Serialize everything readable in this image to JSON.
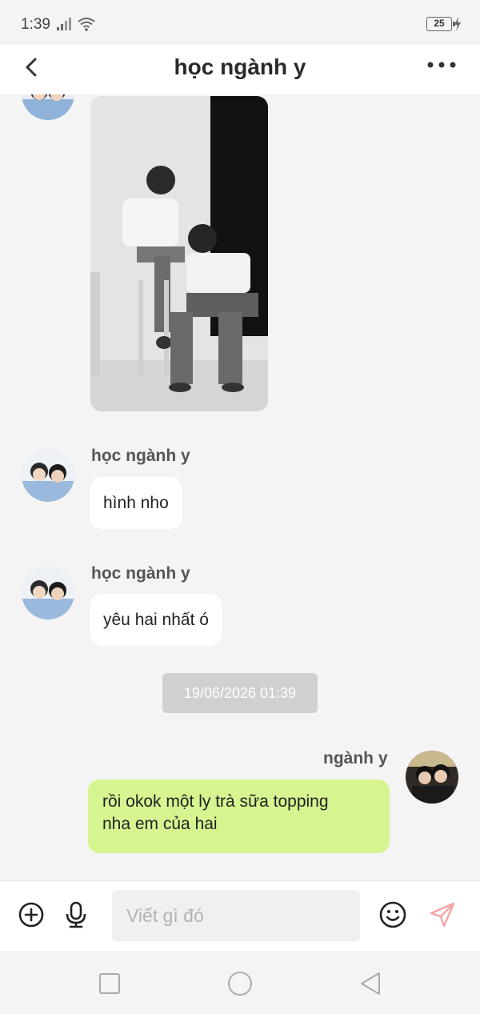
{
  "status_bar": {
    "time": "1:39",
    "battery": "25"
  },
  "header": {
    "title": "học ngành y"
  },
  "messages": [
    {
      "type": "image",
      "direction": "incoming",
      "description_icon": "photo"
    },
    {
      "type": "text",
      "direction": "incoming",
      "sender": "học ngành y",
      "text": "hình nho"
    },
    {
      "type": "text",
      "direction": "incoming",
      "sender": "học ngành y",
      "text": "yêu hai nhất ó"
    },
    {
      "type": "timestamp",
      "text": "19/06/2026 01:39"
    },
    {
      "type": "text",
      "direction": "outgoing",
      "sender": "ngành y",
      "lines": [
        "rồi okok một ly trà sữa topping",
        "nha em của hai"
      ]
    }
  ],
  "composer": {
    "placeholder": "Viết gì đó",
    "icons": [
      "plus-circle-icon",
      "microphone-icon",
      "smiley-icon",
      "send-icon"
    ]
  },
  "colors": {
    "outgoing_bubble": "#d6f48f",
    "incoming_bubble": "#ffffff",
    "background": "#f4f4f4",
    "send_icon": "#f4a3a3"
  }
}
